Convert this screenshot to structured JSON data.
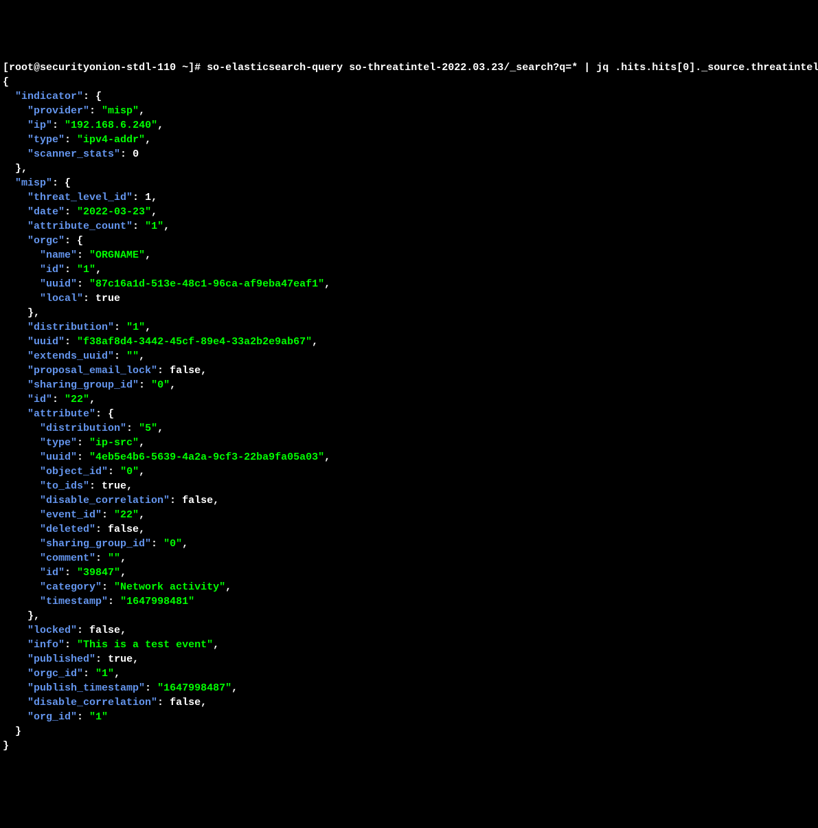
{
  "prompt": {
    "open_bracket": "[",
    "user": "root",
    "at": "@",
    "host": "securityonion-stdl-110",
    "space": " ",
    "path": "~",
    "close_bracket": "]",
    "hash": "# "
  },
  "command": "so-elasticsearch-query so-threatintel-2022.03.23/_search?q=* | jq .hits.hits[0]._source.threatintel",
  "json": {
    "indicator": {
      "provider": "misp",
      "ip": "192.168.6.240",
      "type": "ipv4-addr",
      "scanner_stats": 0
    },
    "misp": {
      "threat_level_id": 1,
      "date": "2022-03-23",
      "attribute_count": "1",
      "orgc": {
        "name": "ORGNAME",
        "id": "1",
        "uuid": "87c16a1d-513e-48c1-96ca-af9eba47eaf1",
        "local": true
      },
      "distribution": "1",
      "uuid": "f38af8d4-3442-45cf-89e4-33a2b2e9ab67",
      "extends_uuid": "",
      "proposal_email_lock": false,
      "sharing_group_id": "0",
      "id": "22",
      "attribute": {
        "distribution": "5",
        "type": "ip-src",
        "uuid": "4eb5e4b6-5639-4a2a-9cf3-22ba9fa05a03",
        "object_id": "0",
        "to_ids": true,
        "disable_correlation": false,
        "event_id": "22",
        "deleted": false,
        "sharing_group_id": "0",
        "comment": "",
        "id": "39847",
        "category": "Network activity",
        "timestamp": "1647998481"
      },
      "locked": false,
      "info": "This is a test event",
      "published": true,
      "orgc_id": "1",
      "publish_timestamp": "1647998487",
      "disable_correlation": false,
      "org_id": "1"
    }
  }
}
